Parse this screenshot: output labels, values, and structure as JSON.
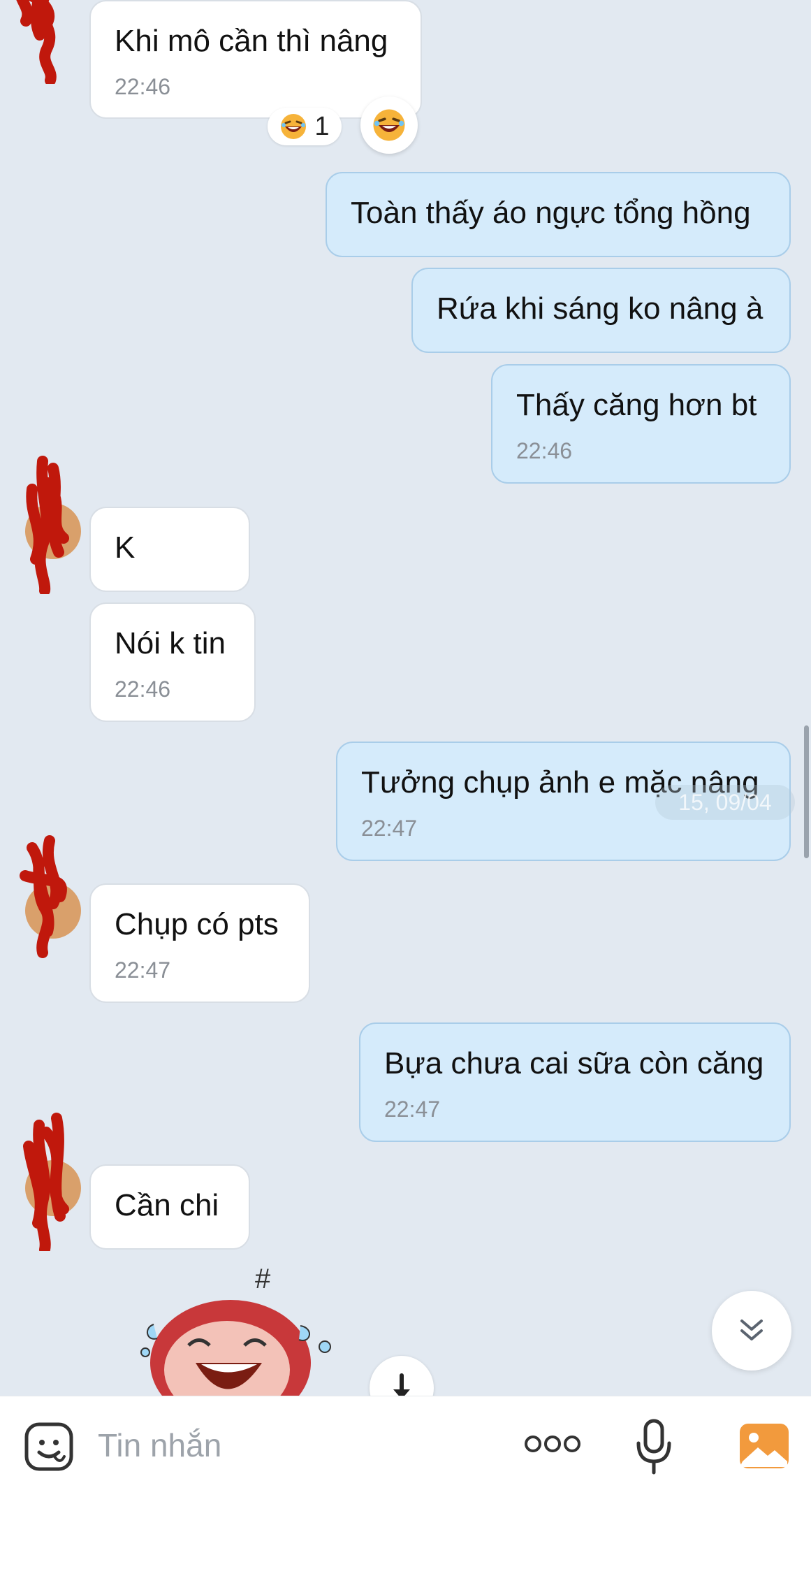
{
  "colors": {
    "background": "#e2e9f1",
    "incoming_bubble": "#ffffff",
    "outgoing_bubble": "#d5ebfb",
    "accent": "#f29a3d"
  },
  "messages": [
    {
      "side": "in",
      "text": "Khi mô cần thì nâng",
      "time": "22:46"
    },
    {
      "side": "out",
      "text": "Toàn thấy áo ngực tổng hồng"
    },
    {
      "side": "out",
      "text": "Rứa khi sáng ko nâng à"
    },
    {
      "side": "out",
      "text": "Thấy căng hơn bt",
      "time": "22:46"
    },
    {
      "side": "in",
      "text": "K"
    },
    {
      "side": "in",
      "text": "Nói k tin",
      "time": "22:46"
    },
    {
      "side": "out",
      "text": "Tưởng chụp ảnh e mặc nâng",
      "time": "22:47"
    },
    {
      "side": "in",
      "text": "Chụp có pts",
      "time": "22:47"
    },
    {
      "side": "out",
      "text": "Bựa chưa cai sữa còn căng",
      "time": "22:47"
    },
    {
      "side": "in",
      "text": "Cần chi"
    }
  ],
  "reaction": {
    "icon": "laughing-face-icon",
    "count": "1"
  },
  "date_divider": "15, 09/04",
  "composer": {
    "placeholder": "Tin nhắn",
    "icons": [
      "sticker-icon",
      "more-options-icon",
      "microphone-icon",
      "gallery-icon"
    ]
  },
  "icons": {
    "scroll_down": "double-chevron-down-icon",
    "jump": "arrow-down-icon"
  }
}
